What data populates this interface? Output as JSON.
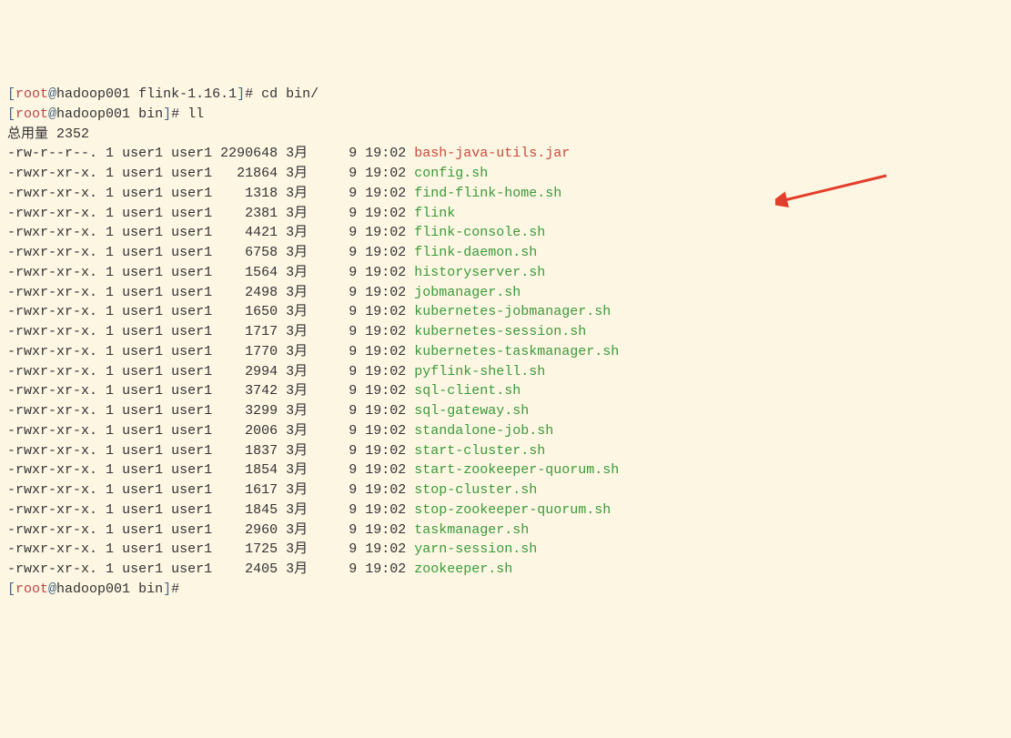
{
  "prompts": [
    {
      "user": "root",
      "host": "hadoop001",
      "cwd": "flink-1.16.1",
      "command": "cd bin/"
    },
    {
      "user": "root",
      "host": "hadoop001",
      "cwd": "bin",
      "command": "ll"
    }
  ],
  "total_label": "总用量 2352",
  "listing": [
    {
      "perms": "-rw-r--r--.",
      "links": "1",
      "owner": "user1",
      "group": "user1",
      "size": "2290648",
      "month_label": "3月",
      "day": "9",
      "time": "19:02",
      "name": "bash-java-utils.jar",
      "type": "archive"
    },
    {
      "perms": "-rwxr-xr-x.",
      "links": "1",
      "owner": "user1",
      "group": "user1",
      "size": "21864",
      "month_label": "3月",
      "day": "9",
      "time": "19:02",
      "name": "config.sh",
      "type": "exec"
    },
    {
      "perms": "-rwxr-xr-x.",
      "links": "1",
      "owner": "user1",
      "group": "user1",
      "size": "1318",
      "month_label": "3月",
      "day": "9",
      "time": "19:02",
      "name": "find-flink-home.sh",
      "type": "exec"
    },
    {
      "perms": "-rwxr-xr-x.",
      "links": "1",
      "owner": "user1",
      "group": "user1",
      "size": "2381",
      "month_label": "3月",
      "day": "9",
      "time": "19:02",
      "name": "flink",
      "type": "exec"
    },
    {
      "perms": "-rwxr-xr-x.",
      "links": "1",
      "owner": "user1",
      "group": "user1",
      "size": "4421",
      "month_label": "3月",
      "day": "9",
      "time": "19:02",
      "name": "flink-console.sh",
      "type": "exec"
    },
    {
      "perms": "-rwxr-xr-x.",
      "links": "1",
      "owner": "user1",
      "group": "user1",
      "size": "6758",
      "month_label": "3月",
      "day": "9",
      "time": "19:02",
      "name": "flink-daemon.sh",
      "type": "exec"
    },
    {
      "perms": "-rwxr-xr-x.",
      "links": "1",
      "owner": "user1",
      "group": "user1",
      "size": "1564",
      "month_label": "3月",
      "day": "9",
      "time": "19:02",
      "name": "historyserver.sh",
      "type": "exec"
    },
    {
      "perms": "-rwxr-xr-x.",
      "links": "1",
      "owner": "user1",
      "group": "user1",
      "size": "2498",
      "month_label": "3月",
      "day": "9",
      "time": "19:02",
      "name": "jobmanager.sh",
      "type": "exec"
    },
    {
      "perms": "-rwxr-xr-x.",
      "links": "1",
      "owner": "user1",
      "group": "user1",
      "size": "1650",
      "month_label": "3月",
      "day": "9",
      "time": "19:02",
      "name": "kubernetes-jobmanager.sh",
      "type": "exec"
    },
    {
      "perms": "-rwxr-xr-x.",
      "links": "1",
      "owner": "user1",
      "group": "user1",
      "size": "1717",
      "month_label": "3月",
      "day": "9",
      "time": "19:02",
      "name": "kubernetes-session.sh",
      "type": "exec"
    },
    {
      "perms": "-rwxr-xr-x.",
      "links": "1",
      "owner": "user1",
      "group": "user1",
      "size": "1770",
      "month_label": "3月",
      "day": "9",
      "time": "19:02",
      "name": "kubernetes-taskmanager.sh",
      "type": "exec"
    },
    {
      "perms": "-rwxr-xr-x.",
      "links": "1",
      "owner": "user1",
      "group": "user1",
      "size": "2994",
      "month_label": "3月",
      "day": "9",
      "time": "19:02",
      "name": "pyflink-shell.sh",
      "type": "exec"
    },
    {
      "perms": "-rwxr-xr-x.",
      "links": "1",
      "owner": "user1",
      "group": "user1",
      "size": "3742",
      "month_label": "3月",
      "day": "9",
      "time": "19:02",
      "name": "sql-client.sh",
      "type": "exec"
    },
    {
      "perms": "-rwxr-xr-x.",
      "links": "1",
      "owner": "user1",
      "group": "user1",
      "size": "3299",
      "month_label": "3月",
      "day": "9",
      "time": "19:02",
      "name": "sql-gateway.sh",
      "type": "exec"
    },
    {
      "perms": "-rwxr-xr-x.",
      "links": "1",
      "owner": "user1",
      "group": "user1",
      "size": "2006",
      "month_label": "3月",
      "day": "9",
      "time": "19:02",
      "name": "standalone-job.sh",
      "type": "exec"
    },
    {
      "perms": "-rwxr-xr-x.",
      "links": "1",
      "owner": "user1",
      "group": "user1",
      "size": "1837",
      "month_label": "3月",
      "day": "9",
      "time": "19:02",
      "name": "start-cluster.sh",
      "type": "exec"
    },
    {
      "perms": "-rwxr-xr-x.",
      "links": "1",
      "owner": "user1",
      "group": "user1",
      "size": "1854",
      "month_label": "3月",
      "day": "9",
      "time": "19:02",
      "name": "start-zookeeper-quorum.sh",
      "type": "exec"
    },
    {
      "perms": "-rwxr-xr-x.",
      "links": "1",
      "owner": "user1",
      "group": "user1",
      "size": "1617",
      "month_label": "3月",
      "day": "9",
      "time": "19:02",
      "name": "stop-cluster.sh",
      "type": "exec"
    },
    {
      "perms": "-rwxr-xr-x.",
      "links": "1",
      "owner": "user1",
      "group": "user1",
      "size": "1845",
      "month_label": "3月",
      "day": "9",
      "time": "19:02",
      "name": "stop-zookeeper-quorum.sh",
      "type": "exec"
    },
    {
      "perms": "-rwxr-xr-x.",
      "links": "1",
      "owner": "user1",
      "group": "user1",
      "size": "2960",
      "month_label": "3月",
      "day": "9",
      "time": "19:02",
      "name": "taskmanager.sh",
      "type": "exec"
    },
    {
      "perms": "-rwxr-xr-x.",
      "links": "1",
      "owner": "user1",
      "group": "user1",
      "size": "1725",
      "month_label": "3月",
      "day": "9",
      "time": "19:02",
      "name": "yarn-session.sh",
      "type": "exec"
    },
    {
      "perms": "-rwxr-xr-x.",
      "links": "1",
      "owner": "user1",
      "group": "user1",
      "size": "2405",
      "month_label": "3月",
      "day": "9",
      "time": "19:02",
      "name": "zookeeper.sh",
      "type": "exec"
    }
  ],
  "footer_prompt": {
    "user": "root",
    "host": "hadoop001",
    "cwd": "bin",
    "command": ""
  },
  "arrow_color": "#e33e2b",
  "size_col_width": 7,
  "day_col_width": 4
}
